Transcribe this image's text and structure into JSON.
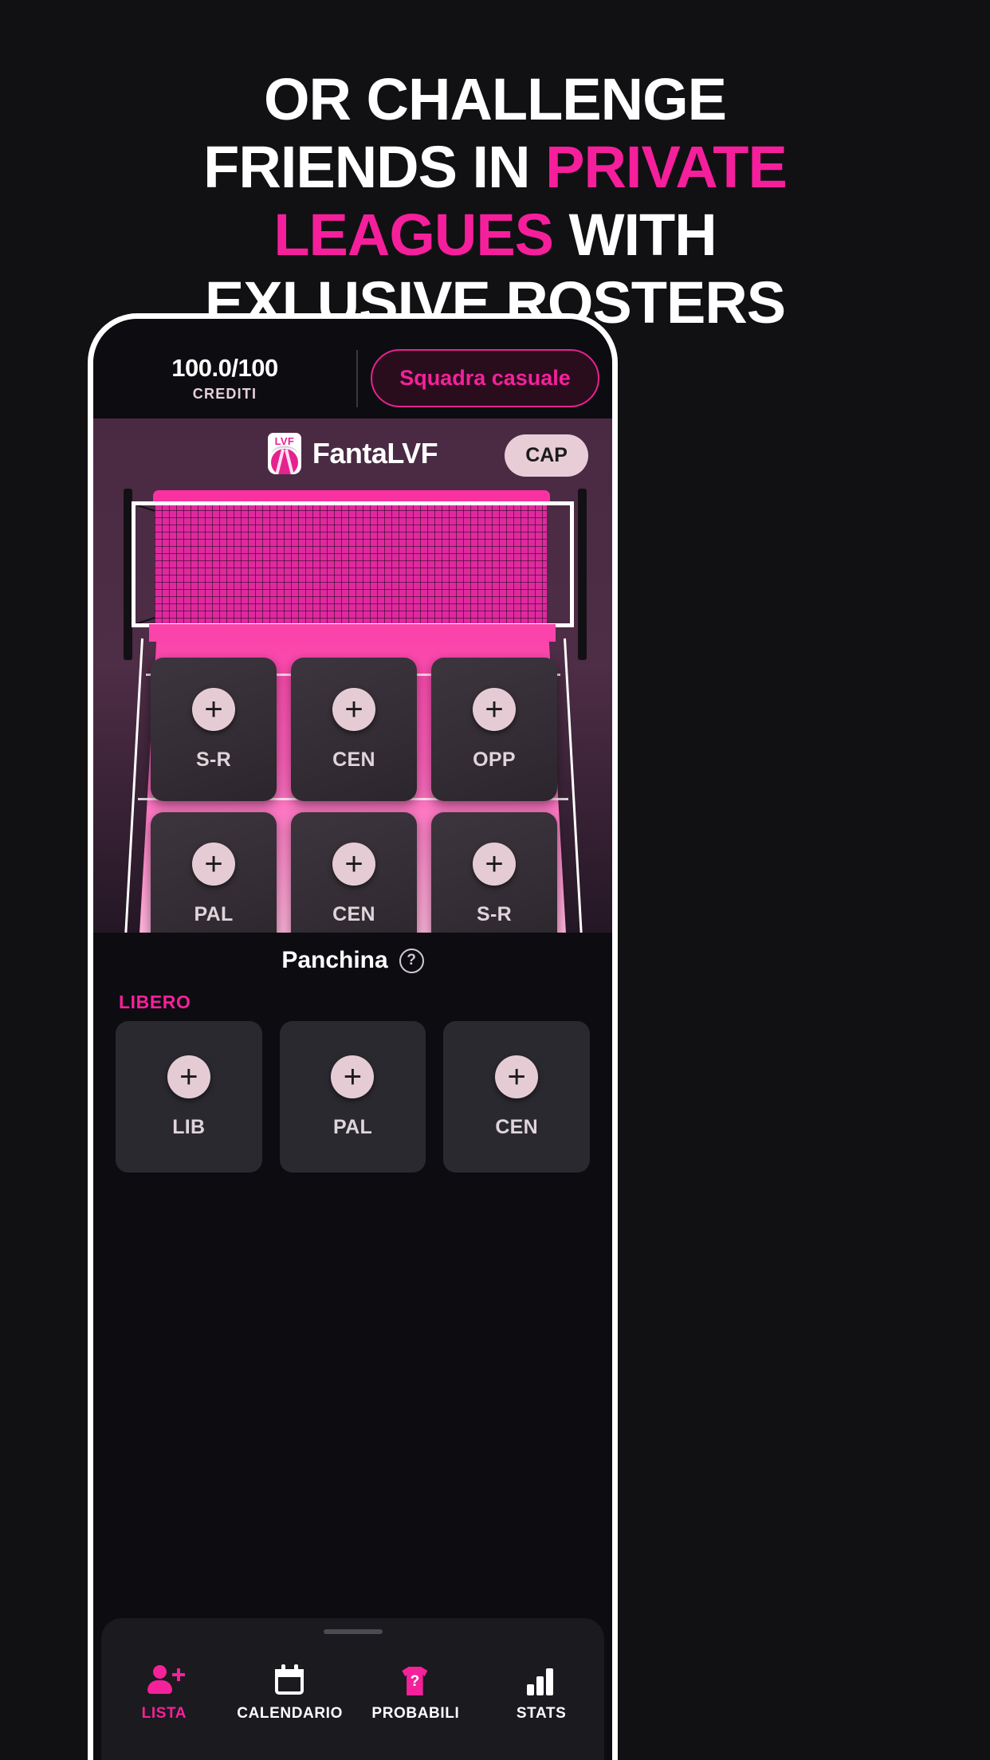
{
  "headline": {
    "line1_white": "OR CHALLENGE",
    "line2_white_a": "FRIENDS IN ",
    "line2_pink": "PRIVATE",
    "line3_pink": "LEAGUES",
    "line3_white": " WITH",
    "line4_white": "EXLUSIVE ROSTERS"
  },
  "app": {
    "credits": {
      "value": "100.0/100",
      "label": "CREDITI"
    },
    "random_team_button": "Squadra casuale",
    "brand": {
      "logo_text": "LVF",
      "name": "FantaLVF"
    },
    "captain_badge": "CAP",
    "court_slots": [
      {
        "label": "S-R",
        "plus": "+"
      },
      {
        "label": "CEN",
        "plus": "+"
      },
      {
        "label": "OPP",
        "plus": "+"
      },
      {
        "label": "PAL",
        "plus": "+"
      },
      {
        "label": "CEN",
        "plus": "+"
      },
      {
        "label": "S-R",
        "plus": "+"
      }
    ],
    "bench": {
      "title": "Panchina",
      "help": "?",
      "libero_label": "LIBERO",
      "slots": [
        {
          "label": "LIB",
          "plus": "+"
        },
        {
          "label": "PAL",
          "plus": "+"
        },
        {
          "label": "CEN",
          "plus": "+"
        }
      ]
    },
    "tabs": [
      {
        "label": "LISTA",
        "icon": "person-add-icon",
        "active": true
      },
      {
        "label": "CALENDARIO",
        "icon": "calendar-icon",
        "active": false
      },
      {
        "label": "PROBABILI",
        "icon": "jersey-question-icon",
        "active": false
      },
      {
        "label": "STATS",
        "icon": "bar-chart-icon",
        "active": false
      }
    ]
  },
  "colors": {
    "accent_pink": "#f5219b",
    "court_pink": "#fb44ab",
    "background": "#111013",
    "panel_purple": "#4a2a43"
  }
}
